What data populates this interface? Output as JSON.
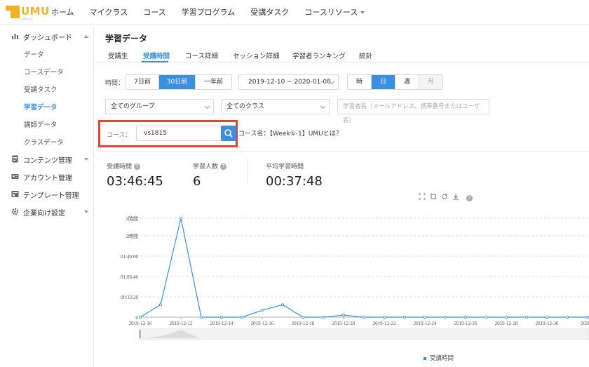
{
  "brand": {
    "logo_text": "UMU",
    "logo_sub": "umu.co"
  },
  "nav": {
    "items": [
      "ホーム",
      "マイクラス",
      "コース",
      "学習プログラム",
      "受講タスク",
      "コースリソース"
    ]
  },
  "sidebar": {
    "dashboard_label": "ダッシュボード",
    "dashboard_items": [
      "データ",
      "コースデータ",
      "受講タスク",
      "学習データ",
      "講師データ",
      "クラスデータ"
    ],
    "active_item": "学習データ",
    "groups": [
      "コンテンツ管理",
      "アカウント管理",
      "テンプレート管理",
      "企業向け設定"
    ]
  },
  "page": {
    "title": "学習データ"
  },
  "tabs": [
    "受講生",
    "受講時間",
    "コース詳細",
    "セッション詳細",
    "学習者ランキング",
    "統計"
  ],
  "active_tab": "受講時間",
  "filters": {
    "time_label": "時間：",
    "range_buttons": [
      "7日前",
      "30日前",
      "一年前"
    ],
    "range_selected": "30日前",
    "date_range": "2019-12-10 ~ 2020-01-08",
    "granularity": [
      "時",
      "日",
      "週",
      "月"
    ],
    "granularity_selected": "日",
    "group_select": "全てのグループ",
    "class_select": "全てのクラス",
    "learner_placeholder": "学習者名（メールアドレス、携帯番号またはユーザ名）",
    "course_label": "コース：",
    "course_value": "vs1815",
    "course_name": "コース名：【Week①-1】UMUとは？"
  },
  "stats": [
    {
      "label": "受講時間",
      "value": "03:46:45"
    },
    {
      "label": "学習人数",
      "value": "6"
    },
    {
      "label": "平均学習時間",
      "value": "00:37:48"
    }
  ],
  "colors": {
    "accent": "#3b8fe0",
    "highlight": "#e8432f"
  },
  "chart_data": {
    "type": "line",
    "x": [
      "2019-12-10",
      "2019-12-11",
      "2019-12-12",
      "2019-12-13",
      "2019-12-14",
      "2019-12-15",
      "2019-12-16",
      "2019-12-17",
      "2019-12-18",
      "2019-12-19",
      "2019-12-20",
      "2019-12-21",
      "2019-12-22",
      "2019-12-23",
      "2019-12-24",
      "2019-12-25",
      "2019-12-26",
      "2019-12-27",
      "2019-12-28",
      "2019-12-29",
      "2019-12-30",
      "2019-12-31",
      "2020-01-01"
    ],
    "xtick_labels": [
      "2019-12-10",
      "2019-12-12",
      "2019-12-14",
      "2019-12-16",
      "2019-12-18",
      "2019-12-20",
      "2019-12-22",
      "2019-12-24",
      "2019-12-26",
      "2019-12-28",
      "2019-12-30",
      "2020-0"
    ],
    "series": [
      {
        "name": "受講時間",
        "values_seconds": [
          0,
          1080,
          8600,
          0,
          0,
          0,
          600,
          1080,
          0,
          0,
          180,
          0,
          0,
          0,
          0,
          0,
          0,
          0,
          0,
          0,
          0,
          0,
          0
        ]
      }
    ],
    "ytick_labels": [
      "0",
      "00:33:20",
      "01:06:40",
      "01:40:00",
      "2時間",
      "2時間"
    ],
    "ylim_seconds": [
      0,
      8600
    ],
    "grid": true,
    "legend": "bottom"
  }
}
